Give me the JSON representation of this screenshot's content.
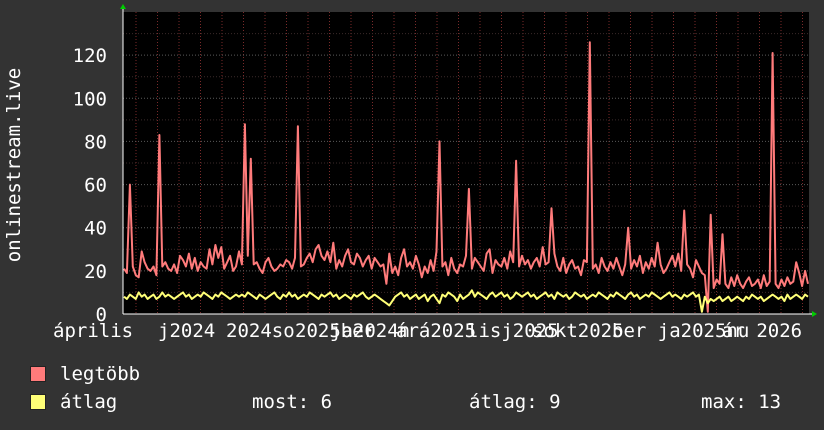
{
  "chart_data": {
    "type": "line",
    "ylabel": "onlinestream.live",
    "ylim": [
      0,
      140
    ],
    "yticks": [
      0,
      20,
      40,
      60,
      80,
      100,
      120
    ],
    "grid": true,
    "colors": {
      "max": "#ff7b7b",
      "avg": "#ffff77",
      "background": "#000000",
      "grid": "#4a4a4a",
      "minor_grid": "#7a2a2a"
    },
    "x_tick_labels": [
      "április 2024",
      "július 2024",
      "október 2024",
      "január 2025",
      "április 2025",
      "július 2025",
      "október 2025",
      "január 2026",
      "április 2026"
    ],
    "x_tick_display": [
      "április",
      "j2024",
      "2024so",
      "2025ber",
      "ja2024n",
      "árá2025",
      "lisj2025",
      "sokt2025",
      "ber ja2025nu",
      "ár 2026"
    ],
    "series": [
      {
        "name": "legtöbb",
        "key": "max",
        "values": [
          21,
          19,
          60,
          22,
          18,
          17,
          29,
          24,
          21,
          20,
          22,
          18,
          83,
          22,
          24,
          21,
          20,
          23,
          19,
          27,
          25,
          22,
          28,
          21,
          26,
          20,
          24,
          22,
          21,
          30,
          23,
          32,
          26,
          31,
          21,
          24,
          27,
          20,
          22,
          29,
          23,
          88,
          27,
          72,
          23,
          24,
          21,
          19,
          24,
          26,
          22,
          20,
          21,
          23,
          22,
          25,
          24,
          21,
          26,
          87,
          22,
          23,
          26,
          28,
          24,
          30,
          32,
          27,
          25,
          29,
          24,
          33,
          21,
          25,
          22,
          27,
          30,
          24,
          23,
          28,
          26,
          22,
          25,
          27,
          21,
          26,
          24,
          22,
          23,
          14,
          28,
          19,
          22,
          18,
          26,
          30,
          22,
          24,
          21,
          27,
          23,
          17,
          22,
          19,
          25,
          20,
          29,
          80,
          22,
          24,
          18,
          26,
          21,
          19,
          23,
          22,
          27,
          58,
          21,
          26,
          24,
          22,
          20,
          28,
          30,
          19,
          25,
          23,
          22,
          26,
          21,
          29,
          24,
          71,
          22,
          27,
          23,
          25,
          21,
          24,
          26,
          22,
          31,
          23,
          24,
          49,
          28,
          22,
          20,
          26,
          19,
          23,
          25,
          21,
          22,
          18,
          25,
          24,
          126,
          21,
          23,
          19,
          26,
          22,
          20,
          24,
          21,
          26,
          22,
          18,
          23,
          40,
          21,
          25,
          22,
          27,
          19,
          24,
          21,
          26,
          22,
          33,
          23,
          19,
          21,
          24,
          27,
          22,
          28,
          20,
          48,
          23,
          21,
          17,
          25,
          22,
          19,
          18,
          1,
          46,
          12,
          16,
          14,
          37,
          14,
          12,
          17,
          13,
          18,
          14,
          12,
          15,
          17,
          13,
          14,
          16,
          12,
          18,
          13,
          15,
          121,
          14,
          12,
          16,
          13,
          17,
          14,
          15,
          24,
          19,
          13,
          20,
          14
        ]
      },
      {
        "name": "átlag",
        "key": "avg",
        "values": [
          8,
          7,
          9,
          8,
          7,
          10,
          8,
          9,
          7,
          8,
          9,
          7,
          8,
          10,
          8,
          9,
          8,
          7,
          8,
          9,
          10,
          8,
          9,
          7,
          8,
          9,
          8,
          10,
          9,
          8,
          7,
          9,
          8,
          10,
          9,
          8,
          7,
          8,
          9,
          8,
          9,
          8,
          10,
          9,
          8,
          7,
          9,
          8,
          7,
          8,
          9,
          10,
          8,
          7,
          9,
          8,
          10,
          8,
          9,
          7,
          8,
          9,
          8,
          10,
          9,
          8,
          7,
          9,
          8,
          9,
          10,
          8,
          9,
          7,
          8,
          9,
          8,
          7,
          9,
          8,
          9,
          10,
          8,
          7,
          8,
          9,
          8,
          7,
          6,
          5,
          4,
          6,
          8,
          9,
          10,
          8,
          9,
          7,
          8,
          9,
          7,
          8,
          9,
          6,
          8,
          9,
          7,
          5,
          9,
          8,
          10,
          9,
          8,
          6,
          9,
          7,
          8,
          9,
          11,
          8,
          10,
          9,
          8,
          7,
          9,
          10,
          8,
          9,
          10,
          8,
          9,
          7,
          8,
          10,
          9,
          8,
          9,
          10,
          8,
          9,
          7,
          8,
          9,
          10,
          8,
          9,
          7,
          10,
          9,
          8,
          9,
          7,
          8,
          10,
          9,
          8,
          9,
          7,
          8,
          9,
          8,
          10,
          9,
          8,
          7,
          9,
          8,
          10,
          9,
          8,
          7,
          9,
          10,
          8,
          9,
          7,
          8,
          9,
          8,
          10,
          9,
          8,
          7,
          8,
          9,
          10,
          8,
          9,
          8,
          7,
          9,
          8,
          9,
          10,
          8,
          9,
          1,
          8,
          5,
          7,
          6,
          7,
          8,
          6,
          7,
          8,
          6,
          7,
          8,
          7,
          6,
          8,
          7,
          9,
          8,
          7,
          8,
          6,
          7,
          8,
          9,
          8,
          7,
          8,
          6,
          9,
          7,
          8,
          9,
          8,
          7,
          9,
          8
        ]
      }
    ]
  },
  "legend": [
    {
      "label": "legtöbb",
      "color": "#ff7b7b"
    },
    {
      "label": "átlag",
      "color": "#ffff77"
    }
  ],
  "stats": {
    "now": "most: 6",
    "avg": "átlag: 9",
    "max": "max: 13"
  }
}
